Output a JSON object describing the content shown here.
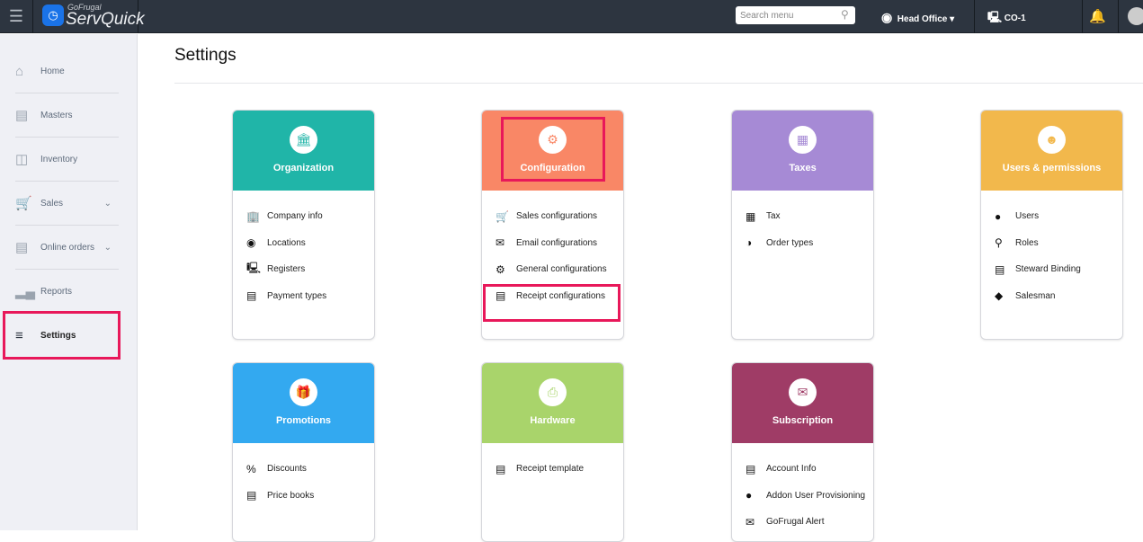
{
  "topbar": {
    "brand_top": "GoFrugal",
    "brand": "ServQuick",
    "search_placeholder": "Search menu",
    "location": "Head Office",
    "register": "CO-1"
  },
  "sidebar": {
    "items": [
      {
        "label": "Home"
      },
      {
        "label": "Masters"
      },
      {
        "label": "Inventory"
      },
      {
        "label": "Sales"
      },
      {
        "label": "Online orders"
      },
      {
        "label": "Reports"
      },
      {
        "label": "Settings"
      }
    ]
  },
  "page": {
    "title": "Settings"
  },
  "cards": [
    {
      "title": "Organization",
      "color": "#20b5a8",
      "items": [
        "Company info",
        "Locations",
        "Registers",
        "Payment types"
      ]
    },
    {
      "title": "Configuration",
      "color": "#f98766",
      "items": [
        "Sales configurations",
        "Email configurations",
        "General configurations",
        "Receipt configurations"
      ]
    },
    {
      "title": "Taxes",
      "color": "#a68ad5",
      "items": [
        "Tax",
        "Order types"
      ]
    },
    {
      "title": "Users & permissions",
      "color": "#f2b84c",
      "items": [
        "Users",
        "Roles",
        "Steward Binding",
        "Salesman"
      ]
    },
    {
      "title": "Promotions",
      "color": "#33a9f0",
      "items": [
        "Discounts",
        "Price books"
      ]
    },
    {
      "title": "Hardware",
      "color": "#a9d46b",
      "items": [
        "Receipt template"
      ]
    },
    {
      "title": "Subscription",
      "color": "#9f3c66",
      "items": [
        "Account Info",
        "Addon User Provisioning",
        "GoFrugal Alert"
      ]
    }
  ]
}
